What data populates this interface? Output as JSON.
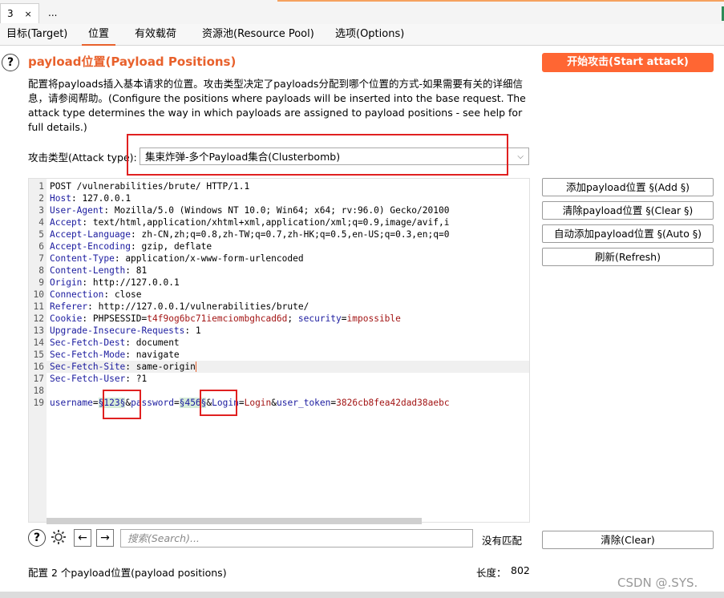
{
  "window_tabs": [
    {
      "label": "3",
      "close": "×"
    },
    {
      "label": "..."
    }
  ],
  "subtabs": [
    "目标(Target)",
    "位置",
    "有效载荷",
    "资源池(Resource Pool)",
    "选项(Options)"
  ],
  "active_subtab": "位置",
  "help_symbol": "?",
  "section": {
    "title": "payload位置(Payload Positions)",
    "description": "配置将payloads插入基本请求的位置。攻击类型决定了payloads分配到哪个位置的方式-如果需要有关的详细信息，请参阅帮助。(Configure the positions where payloads will be inserted into the base request. The attack type determines the way in which payloads are assigned to payload positions - see help for full details.)"
  },
  "start_attack_button": "开始攻击(Start attack)",
  "attack_type": {
    "label": "攻击类型(Attack type):",
    "value": "集束炸弹-多个Payload集合(Clusterbomb)"
  },
  "request_lines": [
    {
      "n": "1",
      "text": "POST /vulnerabilities/brute/ HTTP/1.1"
    },
    {
      "n": "2",
      "key": "Host",
      "val": " 127.0.0.1"
    },
    {
      "n": "3",
      "key": "User-Agent",
      "val": " Mozilla/5.0 (Windows NT 10.0; Win64; x64; rv:96.0) Gecko/20100"
    },
    {
      "n": "4",
      "key": "Accept",
      "val": " text/html,application/xhtml+xml,application/xml;q=0.9,image/avif,i"
    },
    {
      "n": "5",
      "key": "Accept-Language",
      "val": " zh-CN,zh;q=0.8,zh-TW;q=0.7,zh-HK;q=0.5,en-US;q=0.3,en;q=0"
    },
    {
      "n": "6",
      "key": "Accept-Encoding",
      "val": " gzip, deflate"
    },
    {
      "n": "7",
      "key": "Content-Type",
      "val": " application/x-www-form-urlencoded"
    },
    {
      "n": "8",
      "key": "Content-Length",
      "val": " 81"
    },
    {
      "n": "9",
      "key": "Origin",
      "val": " http://127.0.0.1"
    },
    {
      "n": "10",
      "key": "Connection",
      "val": " close"
    },
    {
      "n": "11",
      "key": "Referer",
      "val": " http://127.0.0.1/vulnerabilities/brute/"
    },
    {
      "n": "12",
      "key": "Cookie",
      "cookie": true
    },
    {
      "n": "13",
      "key": "Upgrade-Insecure-Requests",
      "val": " 1"
    },
    {
      "n": "14",
      "key": "Sec-Fetch-Dest",
      "val": " document"
    },
    {
      "n": "15",
      "key": "Sec-Fetch-Mode",
      "val": " navigate"
    },
    {
      "n": "16",
      "key": "Sec-Fetch-Site",
      "val": " same-origin",
      "current": true
    },
    {
      "n": "17",
      "key": "Sec-Fetch-User",
      "val": " ?1"
    },
    {
      "n": "18",
      "text": ""
    },
    {
      "n": "19",
      "body": true
    }
  ],
  "cookie_parts": {
    "name1": " PHPSESSID",
    "val1": "t4f9og6bc71iemciombghcad6d",
    "sep": "; ",
    "name2": "security",
    "val2": "impossible"
  },
  "body_parts": {
    "p1": "username",
    "eq1": "=",
    "m1": "§123§",
    "amp1": "&",
    "p2": "password",
    "eq2": "=",
    "m2": "§456§",
    "amp2": "&",
    "p3": "Login",
    "eq3": "=",
    "v3": "Login",
    "amp3": "&",
    "p4": "user_token",
    "eq4": "=",
    "v4": "3826cb8fea42dad38aebc"
  },
  "side_buttons": {
    "add": "添加payload位置 §(Add §)",
    "clear": "清除payload位置 §(Clear §)",
    "auto": "自动添加payload位置 §(Auto §)",
    "refresh": "刷新(Refresh)",
    "clear_search": "清除(Clear)"
  },
  "search": {
    "placeholder": "搜索(Search)...",
    "no_match": "没有匹配"
  },
  "status": {
    "positions": "配置 2 个payload位置(payload positions)",
    "length_label": "长度：",
    "length_value": "802"
  },
  "watermark": "CSDN @.SYS.",
  "colors": {
    "accent": "#ff6633",
    "title": "#e8612c",
    "annotation": "#e02020",
    "header_key": "#1b1b9f",
    "cookie_value": "#a31515"
  }
}
